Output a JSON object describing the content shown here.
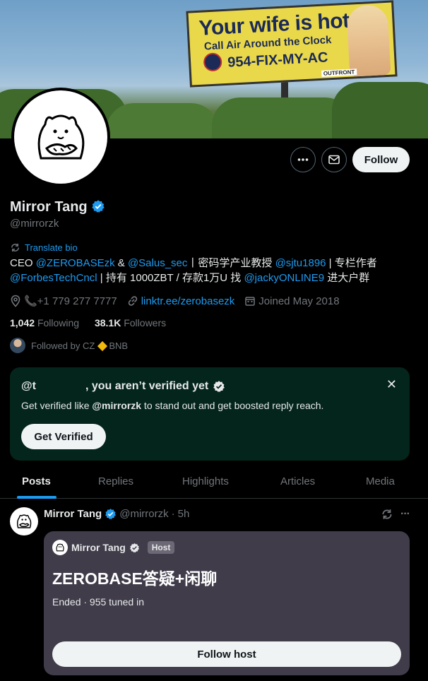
{
  "banner": {
    "billboard_line1": "Your wife is hot",
    "billboard_line2": "Call Air Around the Clock",
    "billboard_line3": "954-FIX-MY-AC",
    "billboard_brand": "OUTFRONT"
  },
  "actions": {
    "follow_label": "Follow"
  },
  "profile": {
    "name": "Mirror Tang",
    "handle": "@mirrorzk",
    "translate_label": "Translate bio",
    "bio": {
      "p1": "CEO ",
      "m1": "@ZEROBASEzk",
      "p2": " & ",
      "m2": "@Salus_sec",
      "p3": "丨密码学产业教授 ",
      "m3": "@sjtu1896",
      "p4": " | 专栏作者",
      "m4": "@ForbesTechCncl",
      "p5": " | 持有 1000ZBT / 存款1万U 找 ",
      "m5": "@jackyONLINE9",
      "p6": " 进大户群"
    },
    "phone": "📞+1 779 277 7777",
    "website": "linktr.ee/zerobasezk",
    "joined": "Joined May 2018",
    "following_count": "1,042",
    "following_label": "Following",
    "followers_count": "38.1K",
    "followers_label": "Followers",
    "followed_by_prefix": "Followed by CZ",
    "followed_by_suffix": "BNB"
  },
  "verify_card": {
    "title_prefix": "@t",
    "title_suffix": ", you aren’t verified yet",
    "description_prefix": "Get verified like ",
    "description_handle": "@mirrorzk",
    "description_suffix": " to stand out and get boosted reply reach.",
    "button_label": "Get Verified",
    "close_label": "✕"
  },
  "tabs": [
    {
      "label": "Posts",
      "active": true
    },
    {
      "label": "Replies",
      "active": false
    },
    {
      "label": "Highlights",
      "active": false
    },
    {
      "label": "Articles",
      "active": false
    },
    {
      "label": "Media",
      "active": false
    }
  ],
  "post": {
    "author_name": "Mirror Tang",
    "author_handle": "@mirrorzk",
    "separator": "·",
    "time": "5h",
    "more_label": "···",
    "space": {
      "host_name": "Mirror Tang",
      "host_badge": "Host",
      "title": "ZEROBASE答疑+闲聊",
      "status": "Ended · 955 tuned in",
      "button_label": "Follow host"
    }
  },
  "colors": {
    "accent": "#1d9bf0",
    "verify_card_bg": "#04251b",
    "space_card_bg": "#403c4a"
  }
}
